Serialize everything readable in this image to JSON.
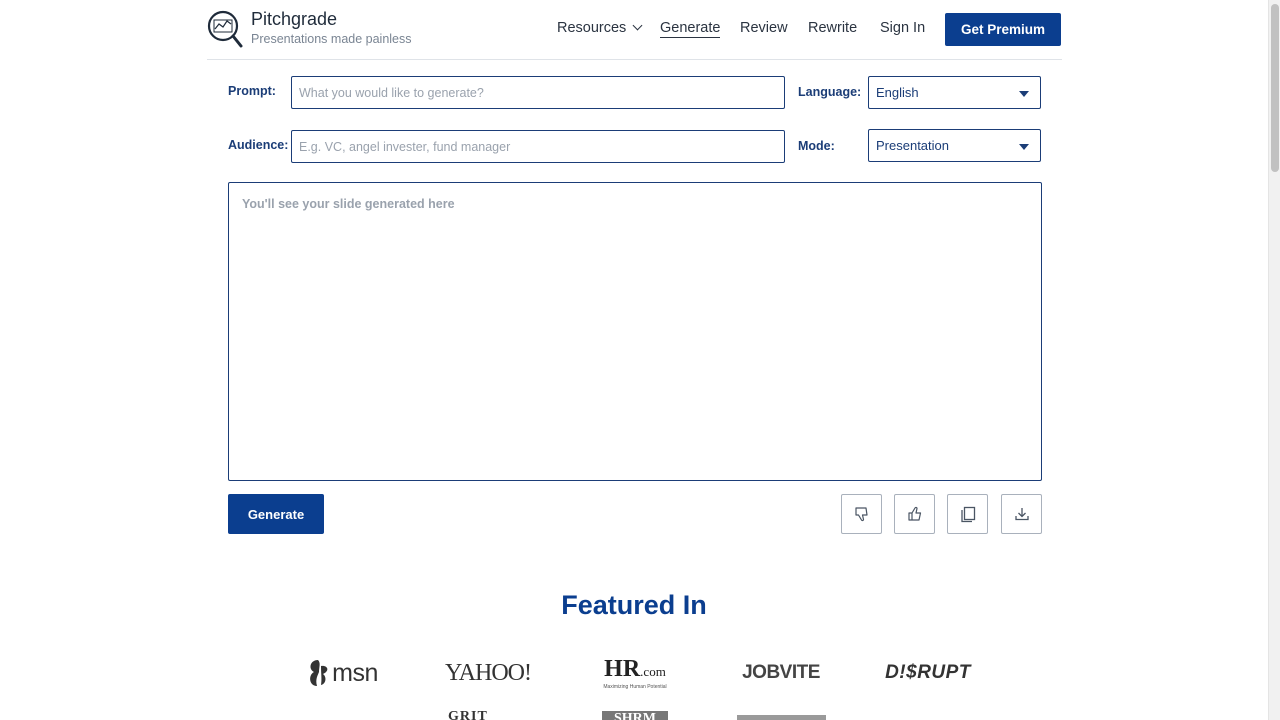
{
  "header": {
    "brand_name": "Pitchgrade",
    "brand_tagline": "Presentations made painless",
    "logo_icon": "magnifier-chart-icon",
    "nav": {
      "resources": "Resources",
      "generate": "Generate",
      "review": "Review",
      "rewrite": "Rewrite",
      "sign_in": "Sign In"
    },
    "active_nav": "Generate",
    "premium_button": "Get Premium"
  },
  "form": {
    "prompt_label": "Prompt:",
    "prompt_value": "",
    "prompt_placeholder": "What you would like to generate?",
    "audience_label": "Audience:",
    "audience_value": "",
    "audience_placeholder": "E.g. VC, angel invester, fund manager",
    "language_label": "Language:",
    "language_value": "English",
    "mode_label": "Mode:",
    "mode_value": "Presentation",
    "output_placeholder": "You'll see your slide generated here"
  },
  "actions": {
    "generate_button": "Generate",
    "icons": [
      "thumbs-down-icon",
      "thumbs-up-icon",
      "copy-icon",
      "download-icon"
    ]
  },
  "featured": {
    "title": "Featured In",
    "logos": {
      "msn": "msn",
      "yahoo": "YAHOO!",
      "hr_main": "HR",
      "hr_suffix": ".com",
      "hr_sub": "Maximizing Human Potential",
      "jobvite": "JOBVITE",
      "disrupt": "D!$RUPT",
      "gritdaily": "GRIT DAILY",
      "shrm": "SHRM"
    }
  },
  "colors": {
    "primary": "#0b3e8f",
    "label": "#1b3d77",
    "placeholder": "#9aa2ad",
    "border_light": "#a9b1bc"
  }
}
